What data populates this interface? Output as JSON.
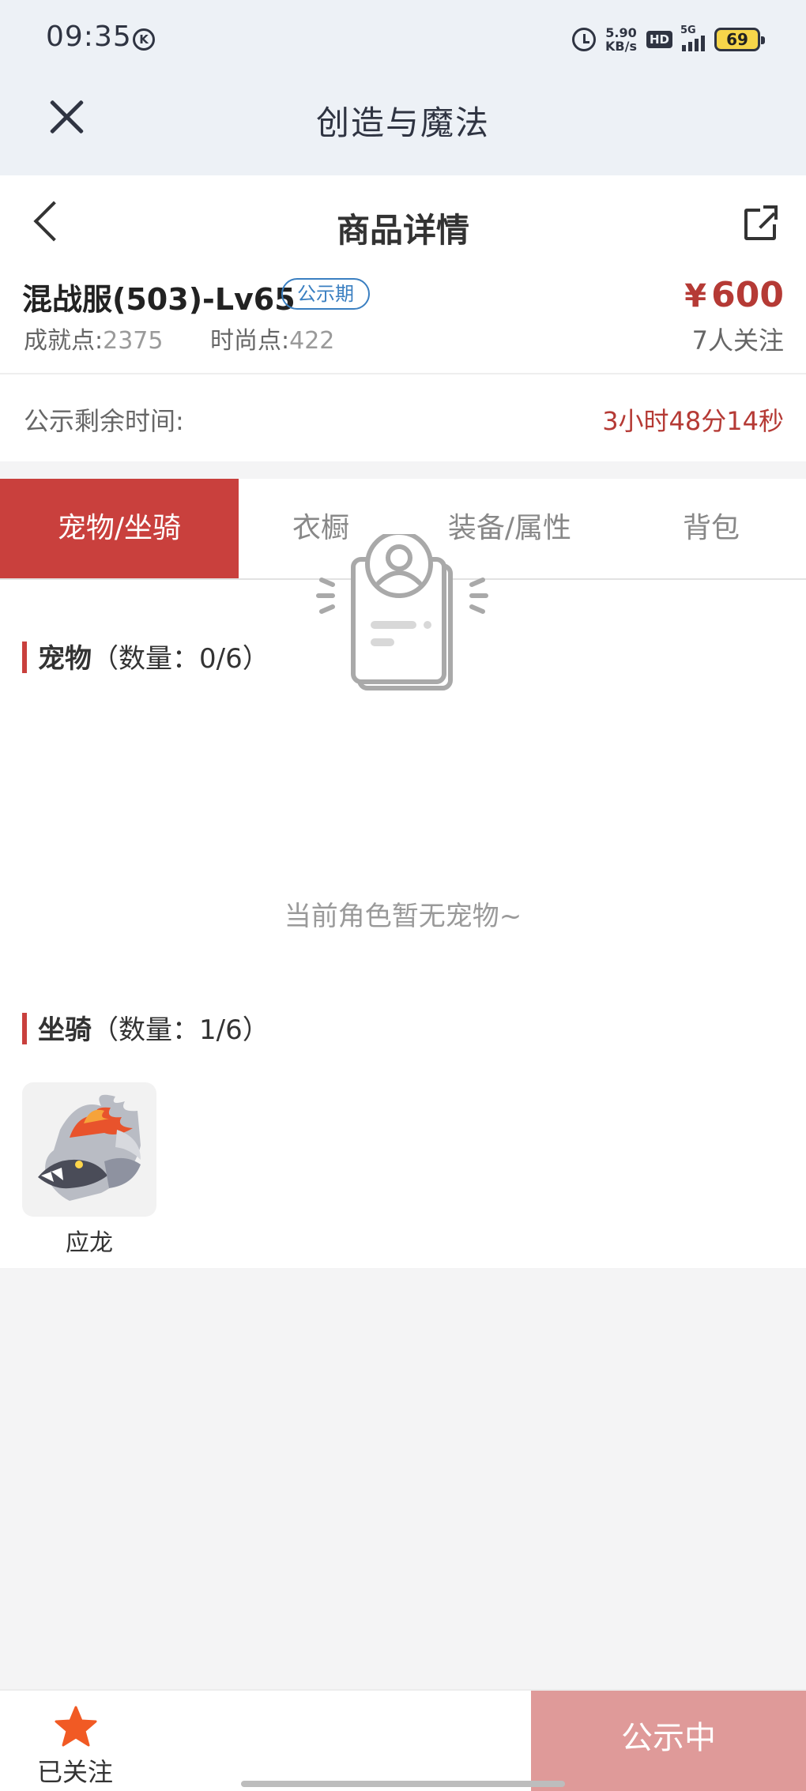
{
  "status_bar": {
    "time": "09:35",
    "k_badge": "K",
    "net_speed_value": "5.90",
    "net_speed_unit": "KB/s",
    "hd_label": "HD",
    "signal_label": "5G",
    "battery": "69"
  },
  "app": {
    "title": "创造与魔法"
  },
  "nav": {
    "title": "商品详情"
  },
  "item": {
    "name": "混战服(503)-Lv65",
    "badge": "公示期",
    "price_symbol": "¥",
    "price": "600",
    "followers": "7人关注",
    "achievement_label": "成就点:",
    "achievement_value": "2375",
    "fashion_label": "时尚点:",
    "fashion_value": "422"
  },
  "countdown": {
    "label": "公示剩余时间:",
    "value": "3小时48分14秒"
  },
  "tabs": [
    {
      "label": "宠物/坐骑",
      "active": true
    },
    {
      "label": "衣橱",
      "active": false
    },
    {
      "label": "装备/属性",
      "active": false
    },
    {
      "label": "背包",
      "active": false
    }
  ],
  "pets": {
    "title": "宠物",
    "count": "（数量：0/6）",
    "empty_text": "当前角色暂无宠物~"
  },
  "mounts": {
    "title": "坐骑",
    "count": "（数量：1/6）",
    "items": [
      {
        "name": "应龙"
      }
    ]
  },
  "bottom": {
    "follow_label": "已关注",
    "status_label": "公示中"
  },
  "colors": {
    "accent": "#c9403d",
    "price": "#b53a35",
    "badge_blue": "#3a7fc1",
    "star": "#f15a24",
    "status_button": "#df9a99"
  }
}
